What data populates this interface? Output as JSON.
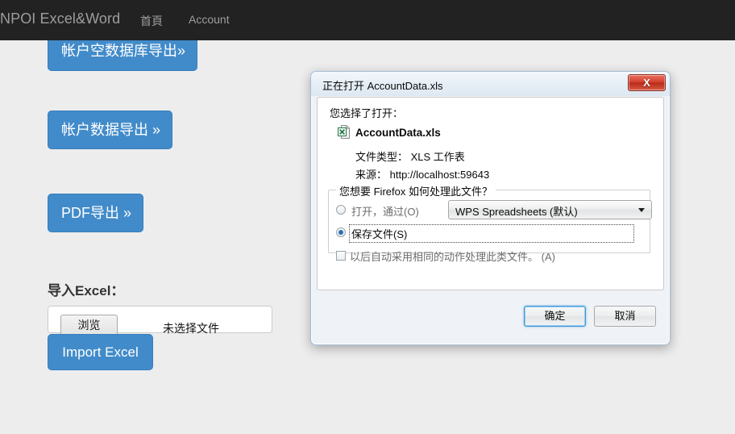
{
  "navbar": {
    "brand": "NPOI Excel&Word",
    "links": [
      {
        "label": "首頁"
      },
      {
        "label": "Account"
      }
    ]
  },
  "main": {
    "export_buttons": [
      {
        "label": "帐户空数据库导出»"
      },
      {
        "label": "帐户数据导出 »"
      },
      {
        "label": "PDF导出 »"
      }
    ],
    "import_section": {
      "title": "导入Excel：",
      "browse_label": "浏览",
      "file_status": "未选择文件",
      "import_button": "Import Excel"
    }
  },
  "dialog": {
    "title": "正在打开 AccountData.xls",
    "close_glyph": "X",
    "intro": "您选择了打开：",
    "filename": "AccountData.xls",
    "file_type": "文件类型： XLS 工作表",
    "source": "来源： http://localhost:59643",
    "question": "您想要 Firefox 如何处理此文件？",
    "open_with_label": "打开，通过(O)",
    "open_with_value": "WPS Spreadsheets (默认)",
    "save_file_label": "保存文件(S)",
    "remember_label": "以后自动采用相同的动作处理此类文件。 (A)",
    "ok_label": "确定",
    "cancel_label": "取消"
  },
  "colors": {
    "navbar_bg": "#222222",
    "page_bg": "#ededed",
    "primary": "#428bca",
    "dialog_chrome": "#eff3f7",
    "close_red": "#d2402c"
  }
}
